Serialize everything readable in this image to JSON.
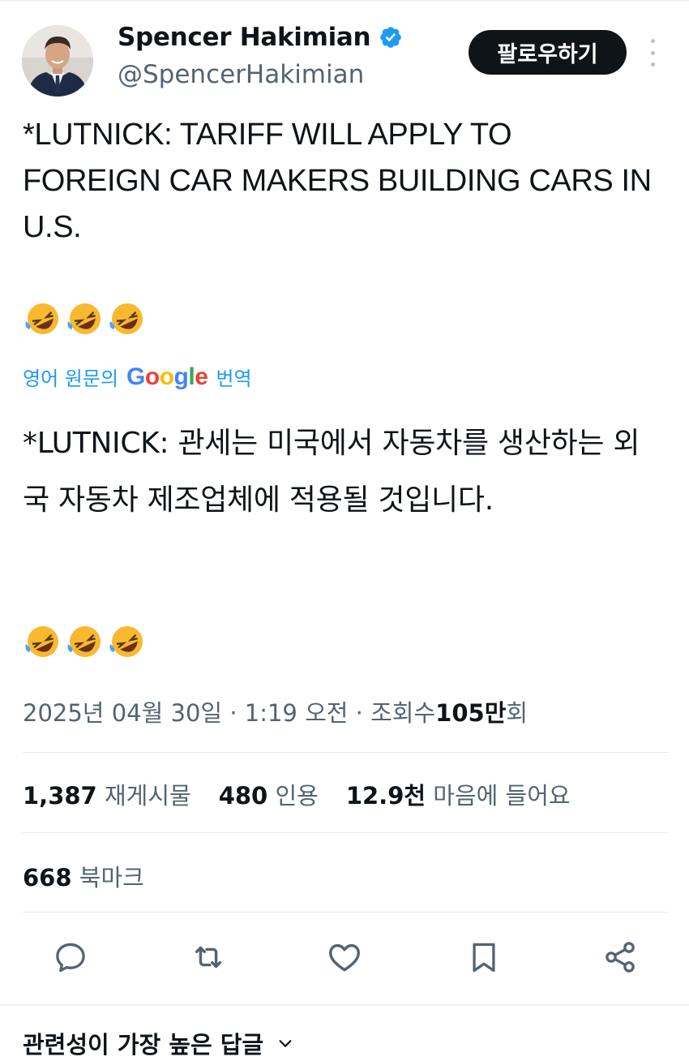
{
  "author": {
    "name": "Spencer Hakimian",
    "handle": "@SpencerHakimian",
    "verified_color": "#1d9bf0"
  },
  "follow_button": {
    "label": "팔로우하기"
  },
  "tweet": {
    "text_en": "*LUTNICK:  TARIFF WILL APPLY TO FOREIGN CAR MAKERS BUILDING CARS IN U.S.",
    "emoji": "🤣🤣🤣",
    "translation": {
      "prefix": "영어 원문의",
      "brand": "Google",
      "suffix": "번역",
      "text_ko": "*LUTNICK: 관세는 미국에서 자동차를 생산하는 외국 자동차 제조업체에 적용될 것입니다.",
      "emoji": "🤣🤣🤣"
    }
  },
  "meta": {
    "date": "2025년 04월 30일",
    "time": "1:19 오전",
    "views_label": "조회수",
    "views_value": "105만",
    "views_suffix": "회",
    "separator": "·"
  },
  "stats": {
    "retweets": {
      "value": "1,387",
      "label": "재게시물"
    },
    "quotes": {
      "value": "480",
      "label": "인용"
    },
    "likes": {
      "value": "12.9천",
      "label": "마음에 들어요"
    },
    "bookmarks": {
      "value": "668",
      "label": "북마크"
    }
  },
  "actions": [
    "reply-icon",
    "retweet-icon",
    "like-icon",
    "bookmark-icon",
    "share-icon"
  ],
  "replies": {
    "sort_label": "관련성이 가장 높은 답글"
  }
}
